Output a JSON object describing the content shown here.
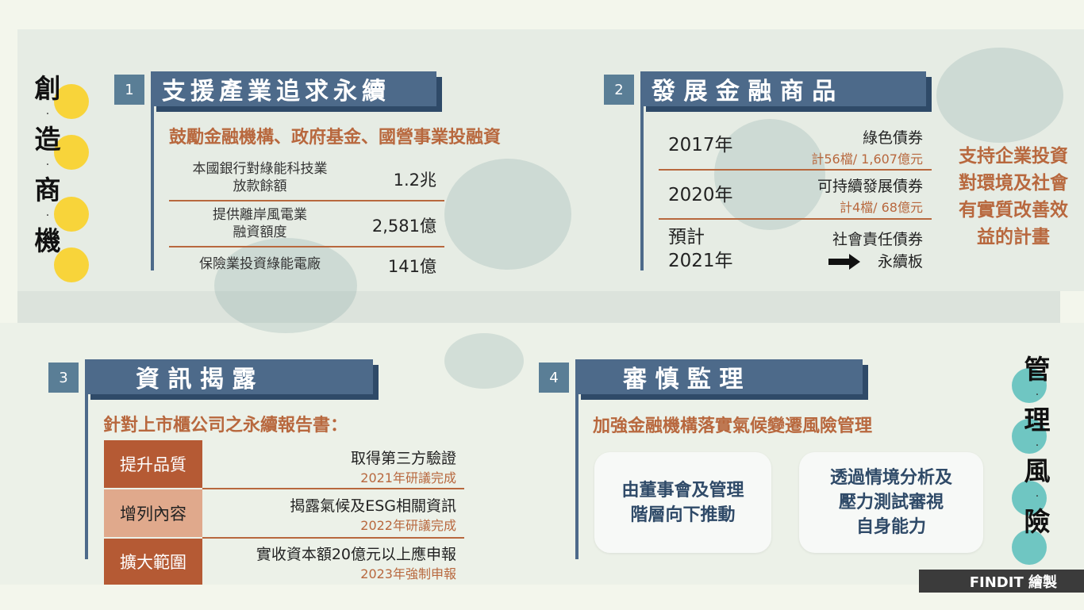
{
  "left_title": {
    "chars": [
      "創",
      "造",
      "商",
      "機"
    ],
    "sep": "·"
  },
  "right_title": {
    "chars": [
      "管",
      "理",
      "風",
      "險"
    ],
    "sep": "·"
  },
  "section1": {
    "num": "1",
    "title": "支援產業追求永續",
    "subtitle": "鼓勵金融機構、政府基金、國營事業投融資",
    "rows": [
      {
        "label": "本國銀行對綠能科技業\n放款餘額",
        "value": "1.2兆"
      },
      {
        "label": "提供離岸風電業\n融資額度",
        "value": "2,581億"
      },
      {
        "label": "保險業投資綠能電廠",
        "value": "141億"
      }
    ]
  },
  "section2": {
    "num": "2",
    "title": "發 展 金 融 商 品",
    "rows": [
      {
        "year": "2017年",
        "name": "綠色債券",
        "sub": "計56檔/ 1,607億元"
      },
      {
        "year": "2020年",
        "name": "可持續發展債券",
        "sub": "計4檔/ 68億元"
      },
      {
        "year_line1": "預計",
        "year_line2": "2021年",
        "name": "社會責任債券",
        "sub2": "永續板"
      }
    ],
    "side_note": "支持企業投資對環境及社會有實質改善效益的計畫"
  },
  "section3": {
    "num": "3",
    "title": "資 訊 揭 露",
    "subtitle": "針對上市櫃公司之永續報告書：",
    "rows": [
      {
        "tag": "提升品質",
        "title": "取得第三方驗證",
        "sub": "2021年研議完成"
      },
      {
        "tag": "增列內容",
        "title": "揭露氣候及ESG相關資訊",
        "sub": "2022年研議完成"
      },
      {
        "tag": "擴大範圍",
        "title": "實收資本額20億元以上應申報",
        "sub": "2023年強制申報"
      }
    ]
  },
  "section4": {
    "num": "4",
    "title": "審 慎 監 理",
    "subtitle": "加強金融機構落實氣候變遷風險管理",
    "cards": [
      "由董事會及管理\n階層向下推動",
      "透過情境分析及\n壓力測試審視\n自身能力"
    ]
  },
  "footer": {
    "credit": "FINDIT 繪製"
  },
  "colors": {
    "accent": "#b8683e",
    "header": "#4d6a8a",
    "yellow": "#f8d43a",
    "teal": "#6fc6c2"
  }
}
